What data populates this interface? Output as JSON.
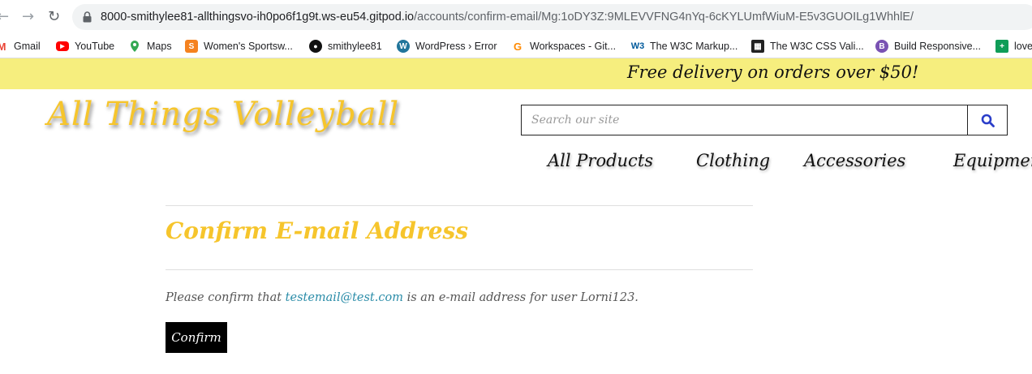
{
  "browser": {
    "url_host": "8000-smithylee81-allthingsvo-ih0po6f1g9t.ws-eu54.gitpod.io",
    "url_path": "/accounts/confirm-email/Mg:1oDY3Z:9MLEVVFNG4nYq-6cKYLUmfWiuM-E5v3GUOILg1WhhlE/",
    "bookmarks": [
      {
        "label": "Gmail",
        "icon": "gmail-icon"
      },
      {
        "label": "YouTube",
        "icon": "youtube-icon"
      },
      {
        "label": "Maps",
        "icon": "maps-icon"
      },
      {
        "label": "Women's Sportsw...",
        "icon": "sportswear-icon"
      },
      {
        "label": "smithylee81",
        "icon": "github-icon"
      },
      {
        "label": "WordPress › Error",
        "icon": "wordpress-icon"
      },
      {
        "label": "Workspaces - Git...",
        "icon": "gitpod-icon"
      },
      {
        "label": "The W3C Markup...",
        "icon": "w3c-icon"
      },
      {
        "label": "The W3C CSS Vali...",
        "icon": "w3c-css-icon"
      },
      {
        "label": "Build Responsive...",
        "icon": "bootstrap-icon"
      },
      {
        "label": "love",
        "icon": "sheets-icon"
      }
    ]
  },
  "site": {
    "promo": "Free delivery on orders over $50!",
    "logo": "All Things Volleyball",
    "search_placeholder": "Search our site",
    "nav": [
      "All Products",
      "Clothing",
      "Accessories",
      "Equipment"
    ]
  },
  "content": {
    "title": "Confirm E-mail Address",
    "message_before": "Please confirm that ",
    "email": "testemail@test.com",
    "message_after": " is an e-mail address for user Lorni123.",
    "confirm_label": "Confirm"
  },
  "colors": {
    "promo_bg": "#f6ee7e",
    "accent_yellow": "#f6c52c",
    "link_teal": "#2a8ca8",
    "search_icon_blue": "#2b3ec9"
  }
}
